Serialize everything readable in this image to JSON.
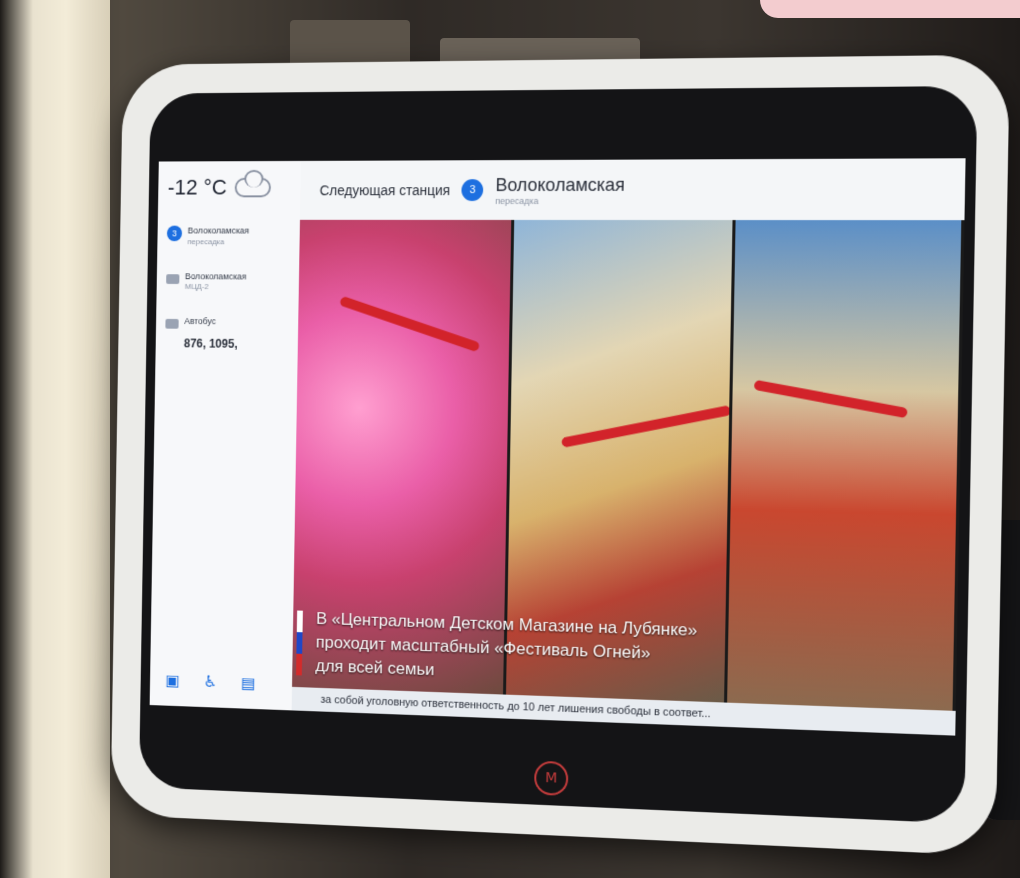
{
  "weather": {
    "temperature": "-12 °C",
    "icon": "cloud-icon"
  },
  "sidebar": {
    "items": [
      {
        "badge": "3",
        "label": "Волоколамская",
        "sub": "пересадка"
      },
      {
        "label": "Волоколамская",
        "sub": "МЦД-2"
      },
      {
        "label": "Автобус",
        "routes": "876, 1095,"
      }
    ],
    "bottom_icons": [
      "book-icon",
      "wheelchair-icon",
      "train-icon"
    ]
  },
  "header": {
    "next_label": "Следующая станция",
    "station_badge": "3",
    "station_name": "Волоколамская",
    "station_sub": "пересадка"
  },
  "caption": {
    "line1": "В «Центральном Детском Магазине на Лубянке»",
    "line2": "проходит масштабный «Фестиваль Огней»",
    "line3": "для всей семьи"
  },
  "ticker": {
    "text": "за собой уголовную ответственность до 10 лет лишения свободы в соответ..."
  },
  "colors": {
    "accent": "#1d6fe0",
    "flag_white": "#ffffff",
    "flag_blue": "#1f47c8",
    "flag_red": "#d32b2b"
  }
}
